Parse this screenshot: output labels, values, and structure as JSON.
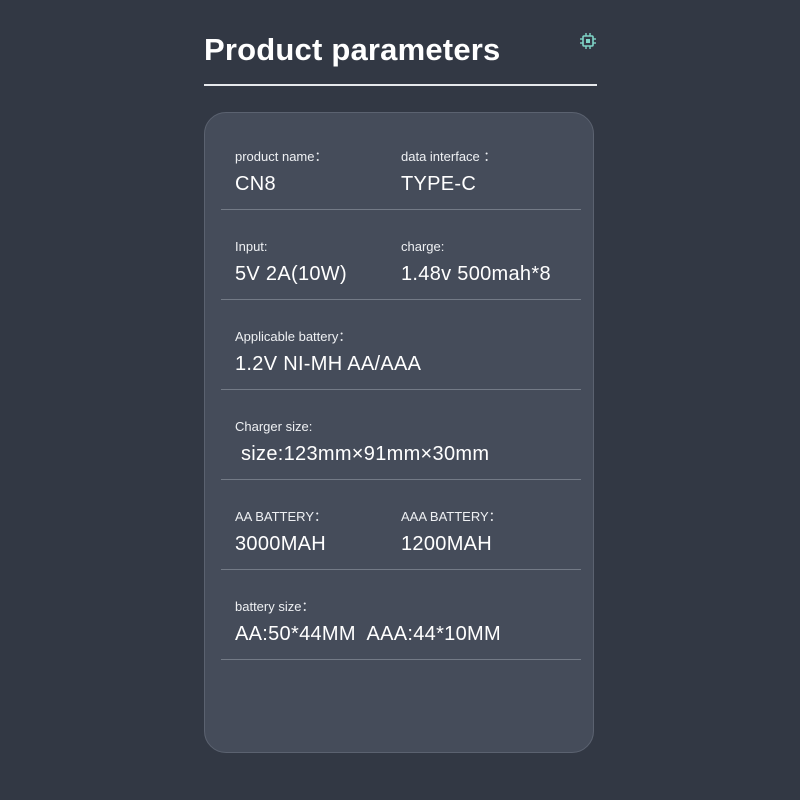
{
  "header": {
    "title": "Product parameters",
    "icon": "chip-icon",
    "accent_color": "#7fd6c8"
  },
  "specs": {
    "product_name": {
      "label": "product name：",
      "value": "CN8"
    },
    "data_interface": {
      "label": "data interface ：",
      "value": "TYPE-C"
    },
    "input": {
      "label": "Input:",
      "value": "5V 2A(10W)"
    },
    "charge": {
      "label": "charge:",
      "value": "1.48v 500mah*8"
    },
    "applicable_battery": {
      "label": "Applicable battery：",
      "value": "1.2V NI-MH AA/AAA"
    },
    "charger_size": {
      "label": "Charger size:",
      "value": "size:123mm×91mm×30mm"
    },
    "aa_battery": {
      "label": "AA BATTERY：",
      "value": "3000MAH"
    },
    "aaa_battery": {
      "label": "AAA BATTERY：",
      "value": "1200MAH"
    },
    "battery_size": {
      "label": "battery size：",
      "value": "AA:50*44MM  AAA:44*10MM"
    }
  }
}
